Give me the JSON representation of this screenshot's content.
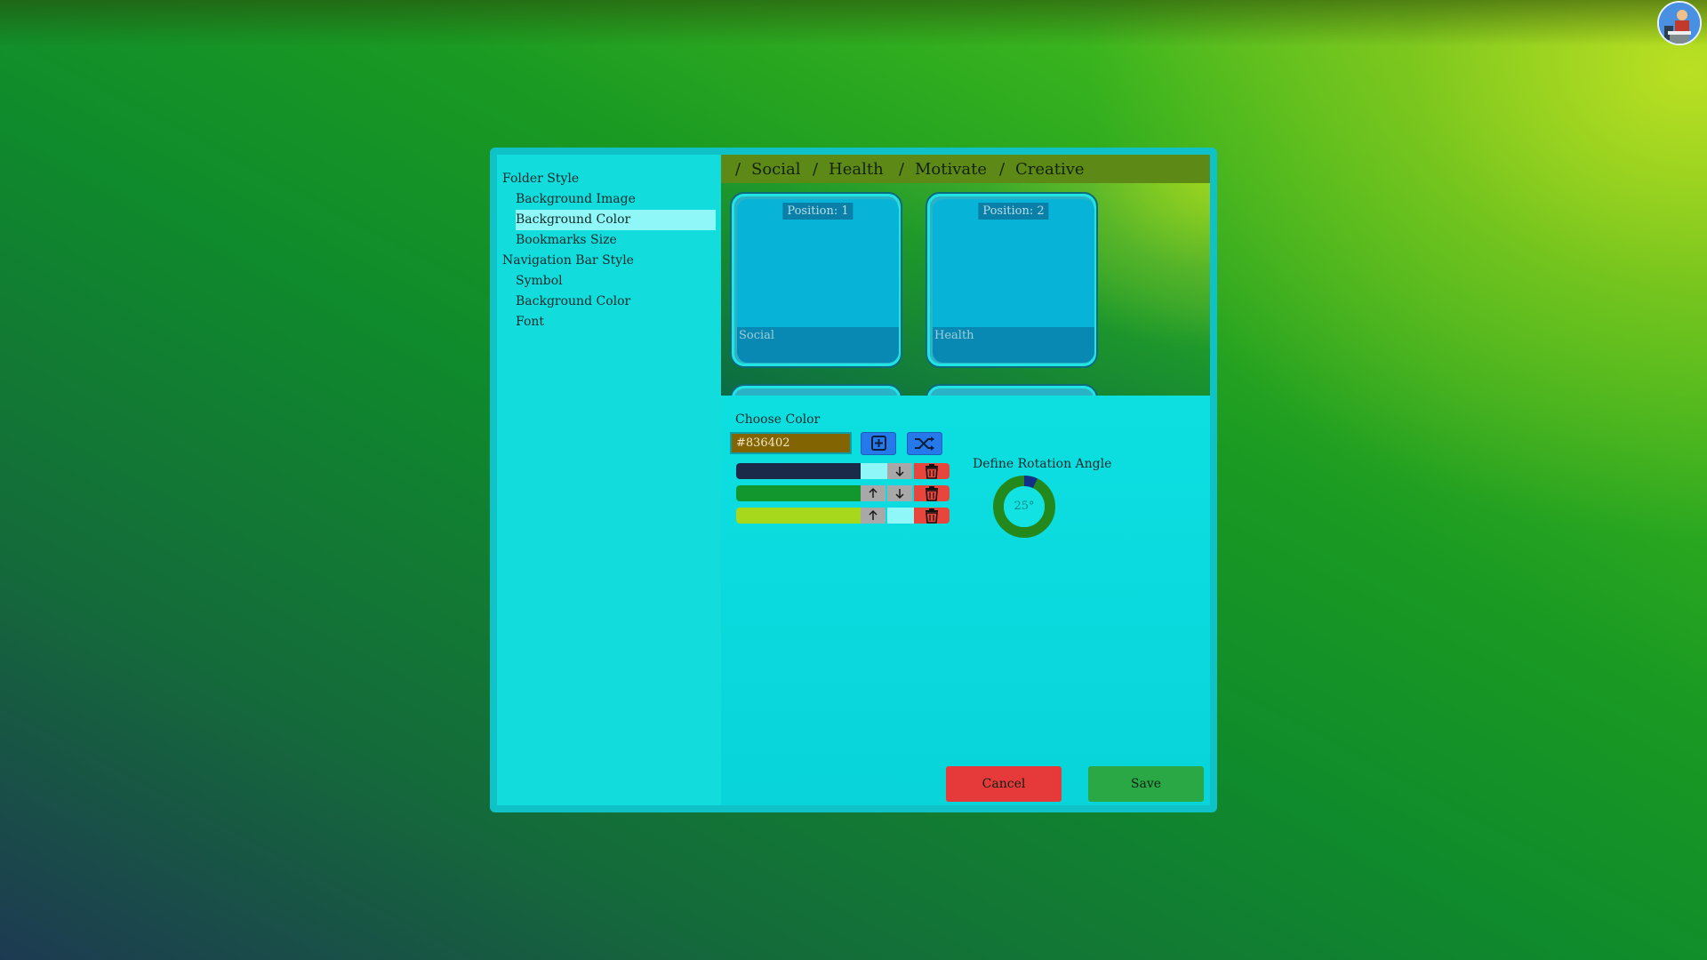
{
  "menu": {
    "groups": [
      {
        "label": "Folder Style",
        "items": [
          "Background Image",
          "Background Color",
          "Bookmarks Size"
        ]
      },
      {
        "label": "Navigation Bar Style",
        "items": [
          "Symbol",
          "Background Color",
          "Font"
        ]
      }
    ],
    "selected": "Background Color"
  },
  "preview": {
    "nav": {
      "separator": "/",
      "tabs": [
        "Social",
        "Health",
        "Motivate",
        "Creative"
      ]
    },
    "folders": [
      {
        "position": "Position: 1",
        "label": "Social"
      },
      {
        "position": "Position: 2",
        "label": "Health"
      }
    ]
  },
  "color_picker": {
    "label": "Choose Color",
    "value": "#836402",
    "gradient_stops": [
      {
        "color": "#1c2a4a"
      },
      {
        "color": "#12962e"
      },
      {
        "color": "#a8d81c"
      }
    ]
  },
  "rotation": {
    "label": "Define Rotation Angle",
    "value": "25°",
    "fraction": 0.07
  },
  "buttons": {
    "cancel": "Cancel",
    "save": "Save"
  },
  "colors": {
    "accent": "#0fd9dc",
    "cancel": "#e63a3a",
    "save": "#2aa845",
    "nav": "#5d8a16"
  },
  "icons": [
    "avatar",
    "add-color-icon",
    "shuffle-icon",
    "arrow-up-icon",
    "arrow-down-icon",
    "trash-icon"
  ]
}
